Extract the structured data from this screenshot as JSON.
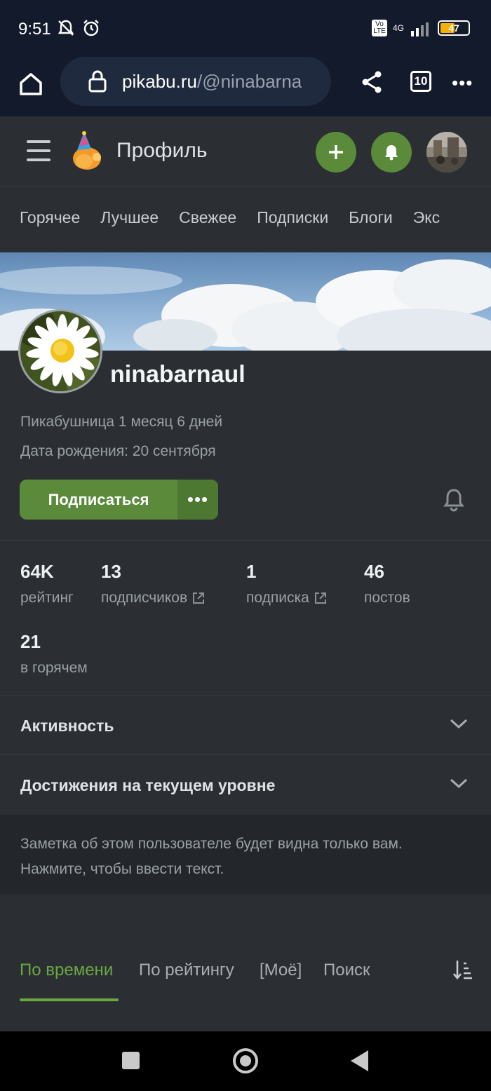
{
  "status_bar": {
    "time": "9:51",
    "volte": "Vo LTE",
    "network": "4G",
    "battery": "47"
  },
  "browser": {
    "url_host": "pikabu.ru",
    "url_path": "/@ninabarna",
    "tab_count": "10",
    "more_label": "•••"
  },
  "header": {
    "title": "Профиль",
    "accent_color": "#5a8a3a"
  },
  "categories": [
    "Горячее",
    "Лучшее",
    "Свежее",
    "Подписки",
    "Блоги",
    "Экс"
  ],
  "profile": {
    "username": "ninabarnaul",
    "member_since": "Пикабушница 1 месяц 6 дней",
    "birthday": "Дата рождения: 20 сентября",
    "subscribe_label": "Подписаться",
    "more_label": "•••"
  },
  "stats": [
    {
      "value": "64K",
      "label": "рейтинг"
    },
    {
      "value": "13",
      "label": "подписчиков"
    },
    {
      "value": "1",
      "label": "подписка"
    },
    {
      "value": "46",
      "label": "постов"
    },
    {
      "value": "21",
      "label": "в горячем"
    }
  ],
  "sections": {
    "activity": "Активность",
    "achievements": "Достижения на текущем уровне"
  },
  "note": {
    "line1": "Заметка об этом пользователе будет видна только вам.",
    "line2": "Нажмите, чтобы ввести текст."
  },
  "sort_tabs": [
    {
      "label": "По времени",
      "active": true
    },
    {
      "label": "По рейтингу",
      "active": false
    },
    {
      "label": "[Моё]",
      "active": false
    },
    {
      "label": "Поиск",
      "active": false
    }
  ]
}
